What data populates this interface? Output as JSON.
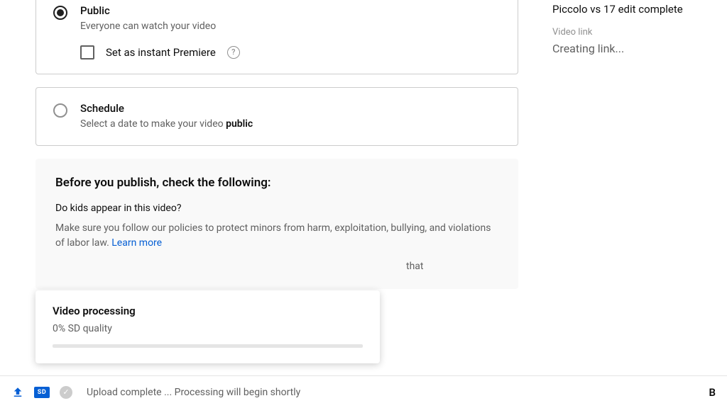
{
  "visibility": {
    "public": {
      "label": "Public",
      "desc": "Everyone can watch your video",
      "premiere_label": "Set as instant Premiere"
    },
    "schedule": {
      "label": "Schedule",
      "desc_prefix": "Select a date to make your video ",
      "desc_bold": "public"
    }
  },
  "checklist": {
    "heading": "Before you publish, check the following:",
    "kids_q": "Do kids appear in this video?",
    "kids_body": "Make sure you follow our policies to protect minors from harm, exploitation, bullying, and violations of labor law. ",
    "learn": "Learn more",
    "overflow": "that"
  },
  "sidebar": {
    "title": "Piccolo vs 17 edit complete",
    "link_label": "Video link",
    "link_status": "Creating link..."
  },
  "popover": {
    "title": "Video processing",
    "status": "0% SD quality"
  },
  "footer": {
    "sd": "SD",
    "text": "Upload complete ... Processing will begin shortly",
    "right": "B"
  }
}
